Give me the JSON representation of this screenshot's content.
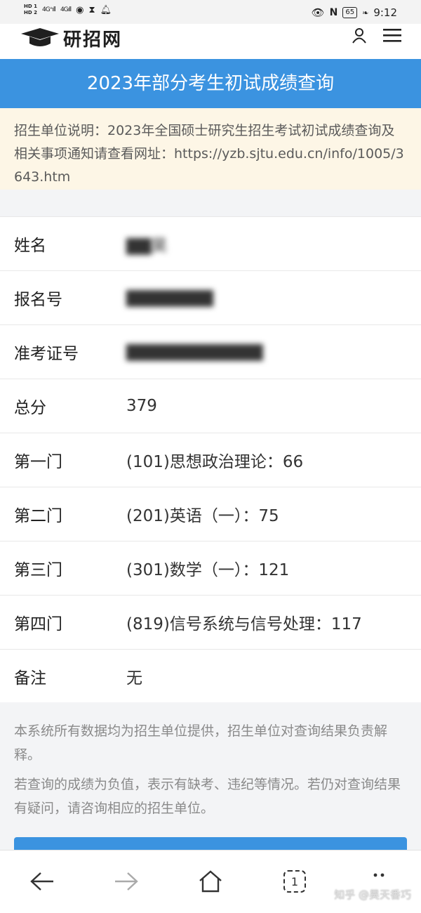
{
  "statusbar": {
    "hd1": "HD 1",
    "hd2": "HD 2",
    "net1": "4G⁺ıll",
    "net2": "4Gıll",
    "time": "9:12",
    "battery": "65"
  },
  "header": {
    "logo_text": "研招网",
    "icons": [
      "logo-cap-icon",
      "user-icon",
      "menu-icon"
    ]
  },
  "page": {
    "title": "2023年部分考生初试成绩查询",
    "notice": "招生单位说明：2023年全国硕士研究生招生考试初试成绩查询及相关事项通知请查看网址：https://yzb.sjtu.edu.cn/info/1005/3643.htm"
  },
  "rows": [
    {
      "label": "姓名",
      "value": "▇▇昊"
    },
    {
      "label": "报名号",
      "value": "▇▇▇▇▇▇▇"
    },
    {
      "label": "准考证号",
      "value": "▇▇▇▇▇▇▇▇▇▇▇"
    },
    {
      "label": "总分",
      "value": "379"
    },
    {
      "label": "第一门",
      "value": "(101)思想政治理论：66"
    },
    {
      "label": "第二门",
      "value": "(201)英语（一）：75"
    },
    {
      "label": "第三门",
      "value": "(301)数学（一）：121"
    },
    {
      "label": "第四门",
      "value": "(819)信号系统与信号处理：117"
    },
    {
      "label": "备注",
      "value": "无"
    }
  ],
  "footer": {
    "note1": "本系统所有数据均为招生单位提供，招生单位对查询结果负责解释。",
    "note2": "若查询的成绩为负值，表示有缺考、违纪等情况。若仍对查询结果有疑问，请咨询相应的招生单位。"
  },
  "nav": {
    "tabs_count": "1",
    "watermark": "知乎 @昊天香巧"
  },
  "colors": {
    "accent": "#3b93e0",
    "notice_bg": "#fdf6e6"
  }
}
